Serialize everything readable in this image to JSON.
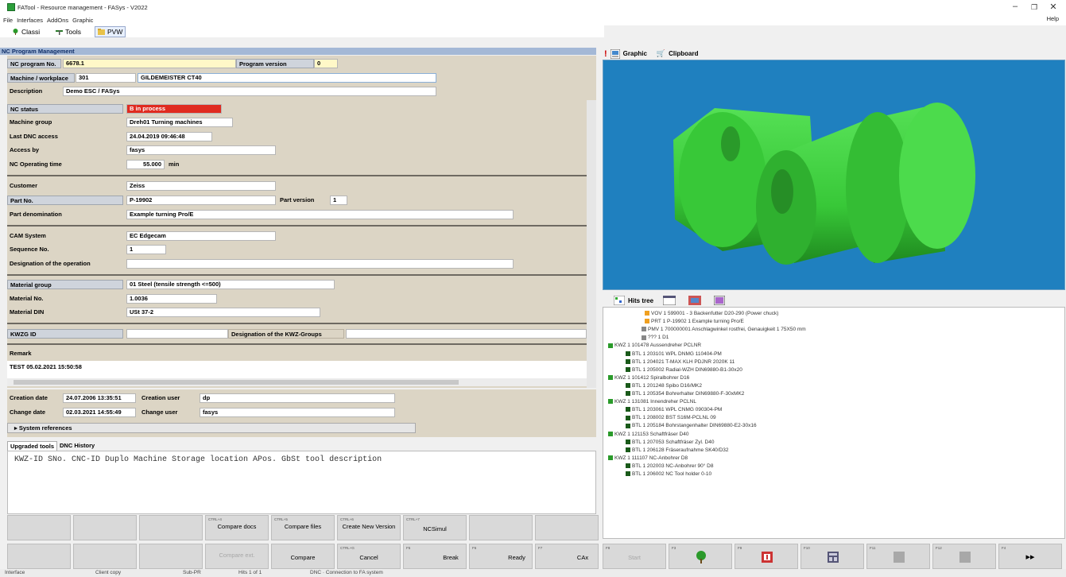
{
  "window": {
    "title": "FATool - Resource management - FASys - V2022",
    "minimize": "–",
    "restore": "❐",
    "close": "✕"
  },
  "menu": {
    "items": [
      "File",
      "Interfaces",
      "AddOns",
      "Graphic"
    ],
    "help": "Help"
  },
  "toolbar": {
    "tabs": [
      "Classi",
      "Tools",
      "PVW"
    ],
    "selected": "PVW"
  },
  "section_title": "NC Program Management",
  "header": {
    "nc_program_no_label": "NC program No.",
    "nc_program_no": "6678.1",
    "program_version_label": "Program version",
    "program_version": "0",
    "machine_label": "Machine / workplace",
    "machine_no": "301",
    "machine_name": "GILDEMEISTER CT40",
    "description_label": "Description",
    "description": "Demo ESC / FASys"
  },
  "details": {
    "nc_status_label": "NC status",
    "nc_status": "B in process",
    "machine_group_label": "Machine group",
    "machine_group": "Dreh01 Turning machines",
    "last_dnc_label": "Last DNC access",
    "last_dnc": "24.04.2019 09:46:48",
    "access_by_label": "Access by",
    "access_by": "fasys",
    "op_time_label": "NC Operating time",
    "op_time": "55.000",
    "op_time_unit": "min",
    "customer_label": "Customer",
    "customer": "Zeiss",
    "part_no_label": "Part No.",
    "part_no": "P-19902",
    "part_version_label": "Part version",
    "part_version": "1",
    "part_denom_label": "Part denomination",
    "part_denom": "Example turning Pro/E",
    "cam_label": "CAM System",
    "cam": "EC Edgecam",
    "seq_label": "Sequence No.",
    "seq": "1",
    "designation_op_label": "Designation of the operation",
    "designation_op": "",
    "material_group_label": "Material group",
    "material_group": "01 Steel (tensile strength <=500)",
    "material_no_label": "Material No.",
    "material_no": "1.0036",
    "material_din_label": "Material DIN",
    "material_din": "USt 37-2",
    "kwzg_label": "KWZG ID",
    "kwzg": "",
    "kwz_groups_label": "Designation of the KWZ-Groups",
    "kwz_groups": "",
    "remark_label": "Remark",
    "remark": "TEST 05.02.2021 15:50:58"
  },
  "dates": {
    "creation_date_label": "Creation date",
    "creation_date": "24.07.2006 13:35:51",
    "creation_user_label": "Creation user",
    "creation_user": "dp",
    "change_date_label": "Change date",
    "change_date": "02.03.2021 14:55:49",
    "change_user_label": "Change user",
    "change_user": "fasys",
    "system_references": "System references"
  },
  "lower_tabs": [
    "Upgraded tools",
    "DNC History"
  ],
  "tool_list_header": "KWZ-ID SNo. CNC-ID Duplo Machine Storage location APos. GbSt tool description",
  "fkeys_row1": [
    {
      "key": "",
      "label": ""
    },
    {
      "key": "",
      "label": ""
    },
    {
      "key": "",
      "label": ""
    },
    {
      "key": "CTRL+4",
      "label": "Compare docs"
    },
    {
      "key": "CTRL+5",
      "label": "Compare files"
    },
    {
      "key": "CTRL+6",
      "label": "Create New Version"
    },
    {
      "key": "CTRL+7",
      "label": "NCSimul"
    },
    {
      "key": "",
      "label": ""
    },
    {
      "key": "",
      "label": ""
    }
  ],
  "fkeys_row2": [
    {
      "key": "",
      "label": ""
    },
    {
      "key": "",
      "label": ""
    },
    {
      "key": "",
      "label": ""
    },
    {
      "key": "",
      "label": "Compare ext."
    },
    {
      "key": "",
      "label": "Compare"
    },
    {
      "key": "CTRL+G",
      "label": "Cancel"
    },
    {
      "key": "F5",
      "label": "Break"
    },
    {
      "key": "F6",
      "label": "Ready"
    },
    {
      "key": "F7",
      "label": "CAx"
    }
  ],
  "right_fkeys": [
    {
      "key": "F8",
      "label": "Start"
    },
    {
      "key": "F3",
      "icon": "tree-icon"
    },
    {
      "key": "F9",
      "icon": "help-book-icon"
    },
    {
      "key": "F10",
      "icon": "calculator-icon"
    },
    {
      "key": "F11",
      "icon": "square-icon"
    },
    {
      "key": "F12",
      "icon": "square-icon"
    },
    {
      "key": "F4",
      "label": "▸▸"
    }
  ],
  "graphic_tabs": [
    "Graphic",
    "Clipboard"
  ],
  "hits_tabs": [
    "Hits tree"
  ],
  "tree_items": [
    "VOV 1 599001 - 3 Backenfutter D20-290 (Power chuck)",
    "PRT 1 P-19902 1 Example turning Pro/E",
    "PMV 1 700000001 Anschlagwinkel rostfrei, Genauigkeit 1 75X50 mm",
    "??? 1 D1",
    "KWZ 1 101478 Aussendreher PCLNR",
    "BTL 1 203101 WPL DNMG 110404-PM",
    "BTL 1 204021 T-MAX KLH PDJNR 2020K 11",
    "BTL 1 205002 Radial-WZH DIN69880-B1-30x20",
    "KWZ 1 101412 Spiralbohrer D16",
    "BTL 1 201248 Spibo D16/MK2",
    "BTL 1 205354 Bohrerhalter DIN69880-F-30xMK2",
    "KWZ 1 131081 Innendreher PCLNL",
    "BTL 1 203061 WPL CNMG 090304-PM",
    "BTL 1 208002 BST S16M-PCLNL 09",
    "BTL 1 205184 Bohrstangenhalter DIN69880-E2-30x16",
    "KWZ 1 121153 Schaftfräser D40",
    "BTL 1 207053 Schaftfräser Zyl. D40",
    "BTL 1 206128 Fräseraufnahme SK40/D32",
    "KWZ 1 111107 NC-Anbohrer D8",
    "BTL 1 202003 NC-Anbohrer 90° D8",
    "BTL 1 206002 NC Tool holder 0-10"
  ],
  "status": {
    "left": "Interface",
    "mid1": "Client copy",
    "mid2": "Sub-PR",
    "mid3": "Hits 1 of 1",
    "right": "DNC · Connection to FA system"
  },
  "colors": {
    "accent": "#a4b8d6",
    "form_bg": "#dcd5c5",
    "status_red": "#e02b20",
    "graphic_bg": "#1f80bf",
    "part_green": "#3ccf3c"
  }
}
